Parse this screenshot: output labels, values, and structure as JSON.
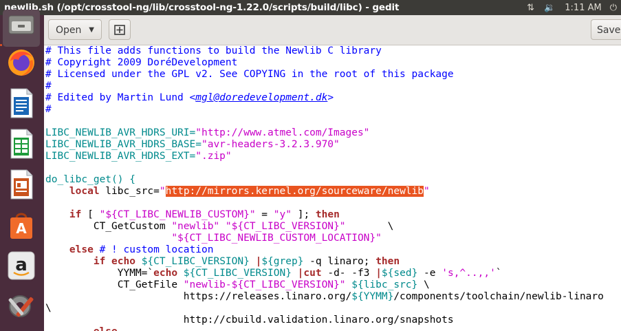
{
  "window": {
    "title": "newlib.sh (/opt/crosstool-ng/lib/crosstool-ng-1.22.0/scripts/build/libc) - gedit"
  },
  "tray": {
    "network_icon": "network-arrows-icon",
    "volume_icon": "speaker-volume-icon",
    "clock": "1:11 AM",
    "power_icon": "power-icon"
  },
  "launcher": {
    "items": [
      {
        "name": "files",
        "icon": "file-cabinet-icon"
      },
      {
        "name": "firefox",
        "icon": "firefox-icon"
      },
      {
        "name": "writer",
        "icon": "libreoffice-writer-icon"
      },
      {
        "name": "calc",
        "icon": "libreoffice-calc-icon"
      },
      {
        "name": "impress",
        "icon": "libreoffice-impress-icon"
      },
      {
        "name": "software",
        "icon": "ubuntu-software-icon"
      },
      {
        "name": "amazon",
        "icon": "amazon-icon"
      },
      {
        "name": "settings",
        "icon": "system-settings-icon"
      }
    ]
  },
  "toolbar": {
    "open_label": "Open",
    "save_label": "Save"
  },
  "editor": {
    "lines": {
      "l1": "# This file adds functions to build the Newlib C library",
      "l2": "# Copyright 2009 DoréDevelopment",
      "l3": "# Licensed under the GPL v2. See COPYING in the root of this package",
      "l4": "#",
      "l5_a": "# Edited by Martin Lund <",
      "l5_b": "mgl@doredevelopment.dk",
      "l5_c": ">",
      "l6": "#",
      "l8_a": "LIBC_NEWLIB_AVR_HDRS_URI=",
      "l8_b": "\"http://www.atmel.com/Images\"",
      "l9_a": "LIBC_NEWLIB_AVR_HDRS_BASE=",
      "l9_b": "\"avr-headers-3.2.3.970\"",
      "l10_a": "LIBC_NEWLIB_AVR_HDRS_EXT=",
      "l10_b": "\".zip\"",
      "l12": "do_libc_get() {",
      "l13_a": "    ",
      "l13_b": "local",
      "l13_c": " libc_src=",
      "l13_d": "\"",
      "l13_e": "http://mirrors.kernel.org/sourceware/newlib",
      "l13_f": "\"",
      "l15_a": "    ",
      "l15_b": "if",
      "l15_c": " [ ",
      "l15_d": "\"${CT_LIBC_NEWLIB_CUSTOM}\"",
      "l15_e": " = ",
      "l15_f": "\"y\"",
      "l15_g": " ]; ",
      "l15_h": "then",
      "l16_a": "        CT_GetCustom ",
      "l16_b": "\"newlib\" \"${CT_LIBC_VERSION}\"",
      "l16_c": "       \\",
      "l17": "                     \"${CT_LIBC_NEWLIB_CUSTOM_LOCATION}\"",
      "l18_a": "    ",
      "l18_b": "else",
      "l18_c": " # ! custom location",
      "l19_a": "        ",
      "l19_b": "if",
      "l19_c": " ",
      "l19_d": "echo",
      "l19_e": " ",
      "l19_f": "${CT_LIBC_VERSION}",
      "l19_g": " ",
      "l19_h": "|",
      "l19_i": "${grep}",
      "l19_j": " -q linaro; ",
      "l19_k": "then",
      "l20_a": "            YYMM=`",
      "l20_b": "echo",
      "l20_c": " ",
      "l20_d": "${CT_LIBC_VERSION}",
      "l20_e": " ",
      "l20_f": "|",
      "l20_g": "cut",
      "l20_h": " -d- -f3 ",
      "l20_i": "|",
      "l20_j": "${sed}",
      "l20_k": " -e ",
      "l20_l": "'s,^..,,'",
      "l20_m": "`",
      "l21_a": "            CT_GetFile ",
      "l21_b": "\"newlib-${CT_LIBC_VERSION}\"",
      "l21_c": " ",
      "l21_d": "${libc_src}",
      "l21_e": " \\",
      "l22_a": "                       https://releases.linaro.org/",
      "l22_b": "${YYMM}",
      "l22_c": "/components/toolchain/newlib-linaro",
      "l23": "\\",
      "l24": "                       http://cbuild.validation.linaro.org/snapshots",
      "l25": "        else"
    }
  }
}
